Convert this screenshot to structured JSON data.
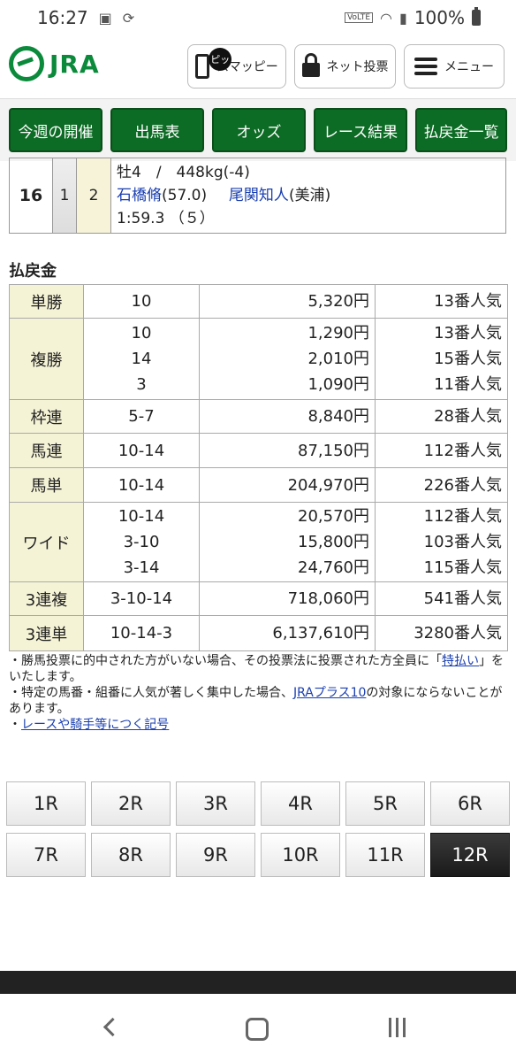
{
  "status": {
    "time": "16:27",
    "battery": "100%",
    "volte": "VoLTE"
  },
  "header": {
    "logo_text": "JRA",
    "smappy": {
      "badge": "ピッ",
      "label": "スマッピー"
    },
    "net_vote": "ネット投票",
    "menu": "メニュー"
  },
  "nav": [
    "今週の開催",
    "出馬表",
    "オッズ",
    "レース結果",
    "払戻金一覧"
  ],
  "horse": {
    "rank": "16",
    "waku": "1",
    "umaban": "2",
    "sex_age_weight": "牡4　/　448kg(-4)",
    "jockey": "石橋脩",
    "jockey_weight": "(57.0)",
    "trainer": "尾関知人",
    "trainer_region": "(美浦)",
    "time_rank": "1:59.3 （５）"
  },
  "payout_title": "払戻金",
  "payouts": [
    {
      "type": "単勝",
      "rows": [
        {
          "num": "10",
          "amount": "5,320円",
          "pop": "13番人気"
        }
      ]
    },
    {
      "type": "複勝",
      "rows": [
        {
          "num": "10",
          "amount": "1,290円",
          "pop": "13番人気"
        },
        {
          "num": "14",
          "amount": "2,010円",
          "pop": "15番人気"
        },
        {
          "num": "3",
          "amount": "1,090円",
          "pop": "11番人気"
        }
      ]
    },
    {
      "type": "枠連",
      "rows": [
        {
          "num": "5-7",
          "amount": "8,840円",
          "pop": "28番人気"
        }
      ]
    },
    {
      "type": "馬連",
      "rows": [
        {
          "num": "10-14",
          "amount": "87,150円",
          "pop": "112番人気"
        }
      ]
    },
    {
      "type": "馬単",
      "rows": [
        {
          "num": "10-14",
          "amount": "204,970円",
          "pop": "226番人気"
        }
      ]
    },
    {
      "type": "ワイド",
      "rows": [
        {
          "num": "10-14",
          "amount": "20,570円",
          "pop": "112番人気"
        },
        {
          "num": "3-10",
          "amount": "15,800円",
          "pop": "103番人気"
        },
        {
          "num": "3-14",
          "amount": "24,760円",
          "pop": "115番人気"
        }
      ]
    },
    {
      "type": "3連複",
      "rows": [
        {
          "num": "3-10-14",
          "amount": "718,060円",
          "pop": "541番人気"
        }
      ]
    },
    {
      "type": "3連単",
      "rows": [
        {
          "num": "10-14-3",
          "amount": "6,137,610円",
          "pop": "3280番人気"
        }
      ]
    }
  ],
  "notes": {
    "note1_a": "・勝馬投票に的中された方がいない場合、その投票法に投票された方全員に「",
    "note1_link": "特払い",
    "note1_b": "」をいたします。",
    "note2_a": "・特定の馬番・組番に人気が著しく集中した場合、",
    "note2_link": "JRAプラス10",
    "note2_b": "の対象にならないことがあります。",
    "note3_a": "・",
    "note3_link": "レースや騎手等につく記号"
  },
  "races": [
    "1R",
    "2R",
    "3R",
    "4R",
    "5R",
    "6R",
    "7R",
    "8R",
    "9R",
    "10R",
    "11R",
    "12R"
  ],
  "active_race": "12R"
}
